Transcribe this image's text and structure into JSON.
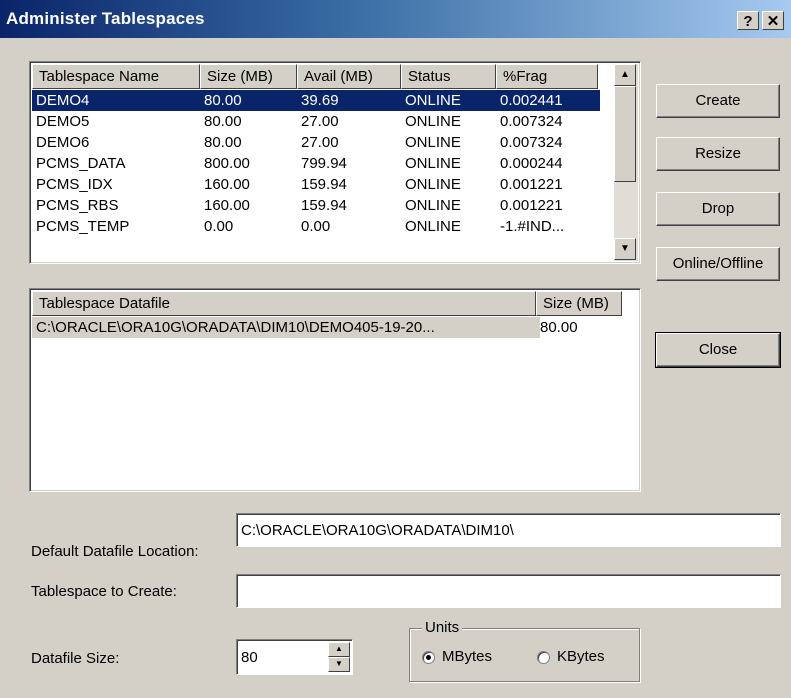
{
  "window": {
    "title": "Administer Tablespaces",
    "help_label": "?",
    "close_label": "✕"
  },
  "tablespaces": {
    "headers": [
      "Tablespace Name",
      "Size (MB)",
      "Avail (MB)",
      "Status",
      "%Frag"
    ],
    "rows": [
      [
        "DEMO4",
        "80.00",
        "39.69",
        "ONLINE",
        "0.002441"
      ],
      [
        "DEMO5",
        "80.00",
        "27.00",
        "ONLINE",
        "0.007324"
      ],
      [
        "DEMO6",
        "80.00",
        "27.00",
        "ONLINE",
        "0.007324"
      ],
      [
        "PCMS_DATA",
        "800.00",
        "799.94",
        "ONLINE",
        "0.000244"
      ],
      [
        "PCMS_IDX",
        "160.00",
        "159.94",
        "ONLINE",
        "0.001221"
      ],
      [
        "PCMS_RBS",
        "160.00",
        "159.94",
        "ONLINE",
        "0.001221"
      ],
      [
        "PCMS_TEMP",
        "0.00",
        "0.00",
        "ONLINE",
        "-1.#IND..."
      ]
    ],
    "selected_row": 0
  },
  "datafiles": {
    "headers": [
      "Tablespace Datafile",
      "Size (MB)"
    ],
    "rows": [
      [
        "C:\\ORACLE\\ORA10G\\ORADATA\\DIM10\\DEMO405-19-20...",
        "80.00"
      ]
    ]
  },
  "buttons": {
    "create": "Create",
    "resize": "Resize",
    "drop": "Drop",
    "online_offline": "Online/Offline",
    "close": "Close"
  },
  "form": {
    "default_location_label": "Default Datafile Location:",
    "default_location_value": "C:\\ORACLE\\ORA10G\\ORADATA\\DIM10\\",
    "tablespace_label": "Tablespace to Create:",
    "tablespace_value": "",
    "datafile_size_label": "Datafile Size:",
    "datafile_size_value": "80"
  },
  "units": {
    "title": "Units",
    "mbytes": "MBytes",
    "kbytes": "KBytes",
    "selected": "MBytes"
  },
  "colors": {
    "face": "#d4d0c8",
    "selection": "#0a246a"
  }
}
